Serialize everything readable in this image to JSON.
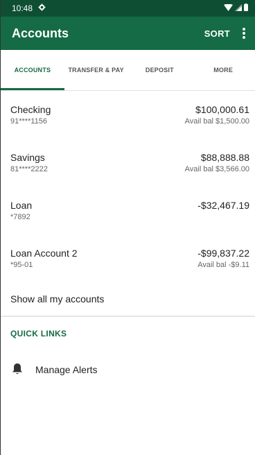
{
  "status": {
    "time": "10:48"
  },
  "app": {
    "title": "Accounts",
    "sort_label": "SORT"
  },
  "tabs": [
    {
      "label": "ACCOUNTS"
    },
    {
      "label": "TRANSFER & PAY"
    },
    {
      "label": "DEPOSIT"
    },
    {
      "label": "MORE"
    }
  ],
  "accounts": [
    {
      "name": "Checking",
      "number": "91****1156",
      "balance": "$100,000.61",
      "available": "Avail bal $1,500.00"
    },
    {
      "name": "Savings",
      "number": "81****2222",
      "balance": "$88,888.88",
      "available": "Avail bal $3,566.00"
    },
    {
      "name": "Loan",
      "number": "*7892",
      "balance": "-$32,467.19",
      "available": ""
    },
    {
      "name": "Loan Account 2",
      "number": "*95-01",
      "balance": "-$99,837.22",
      "available": "Avail bal -$9.11"
    }
  ],
  "show_all_label": "Show all my accounts",
  "quick_links": {
    "title": "QUICK LINKS",
    "items": [
      {
        "label": "Manage Alerts",
        "icon": "bell-icon"
      }
    ]
  },
  "colors": {
    "status_bar": "#0e4f34",
    "app_bar": "#146b45",
    "accent": "#146b45"
  }
}
